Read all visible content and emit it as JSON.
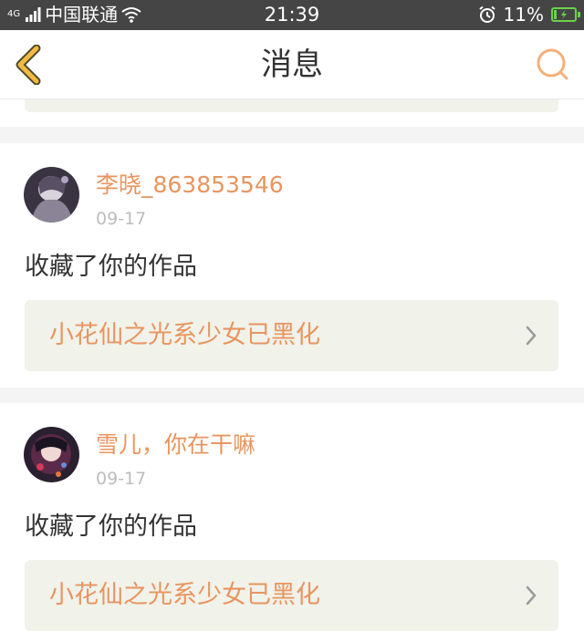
{
  "status_bar": {
    "network": "4G",
    "carrier": "中国联通",
    "time": "21:39",
    "battery_pct": "11%",
    "icons": [
      "signal-icon",
      "wifi-icon",
      "alarm-icon",
      "battery-charging-icon"
    ]
  },
  "header": {
    "title": "消息",
    "back_icon": "back-chevron-icon",
    "search_icon": "search-icon",
    "accent_color": "#f4b942"
  },
  "messages": [
    {
      "user": "李晓_863853546",
      "date": "09-17",
      "action": "收藏了你的作品",
      "work_title": "小花仙之光系少女已黑化"
    },
    {
      "user": "雪儿，你在干嘛",
      "date": "09-17",
      "action": "收藏了你的作品",
      "work_title": "小花仙之光系少女已黑化"
    }
  ],
  "colors": {
    "name_color": "#e8955f",
    "card_bg": "#f1f2ea",
    "page_bg": "#f4f4f4"
  }
}
